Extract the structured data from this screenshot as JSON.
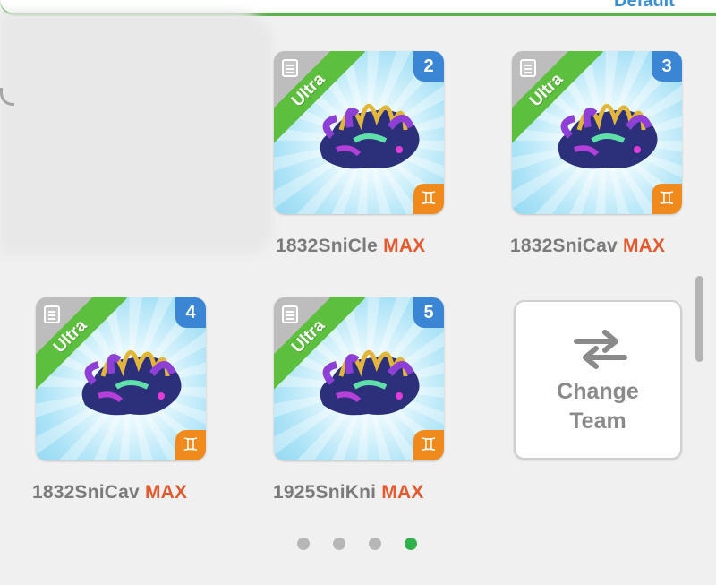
{
  "header": {
    "right_text": "Default"
  },
  "cards": [
    {
      "badge": "Ultra",
      "number": "2",
      "name": "1832SniCle",
      "level": "MAX",
      "class_icon": "gemini-class-icon"
    },
    {
      "badge": "Ultra",
      "number": "3",
      "name": "1832SniCav",
      "level": "MAX",
      "class_icon": "gemini-class-icon"
    },
    {
      "badge": "Ultra",
      "number": "4",
      "name": "1832SniCav",
      "level": "MAX",
      "class_icon": "gemini-class-icon"
    },
    {
      "badge": "Ultra",
      "number": "5",
      "name": "1925SniKni",
      "level": "MAX",
      "class_icon": "gemini-class-icon"
    }
  ],
  "change_team": {
    "line1": "Change",
    "line2": "Team",
    "icon": "swap-arrows-icon"
  },
  "pagination": {
    "total": 4,
    "active_index": 3
  },
  "colors": {
    "accent_green": "#31b14c",
    "rarity_green": "#5cbf3e",
    "number_blue": "#3a86d4",
    "class_orange": "#f08a1d",
    "max_red": "#e35a2e"
  }
}
